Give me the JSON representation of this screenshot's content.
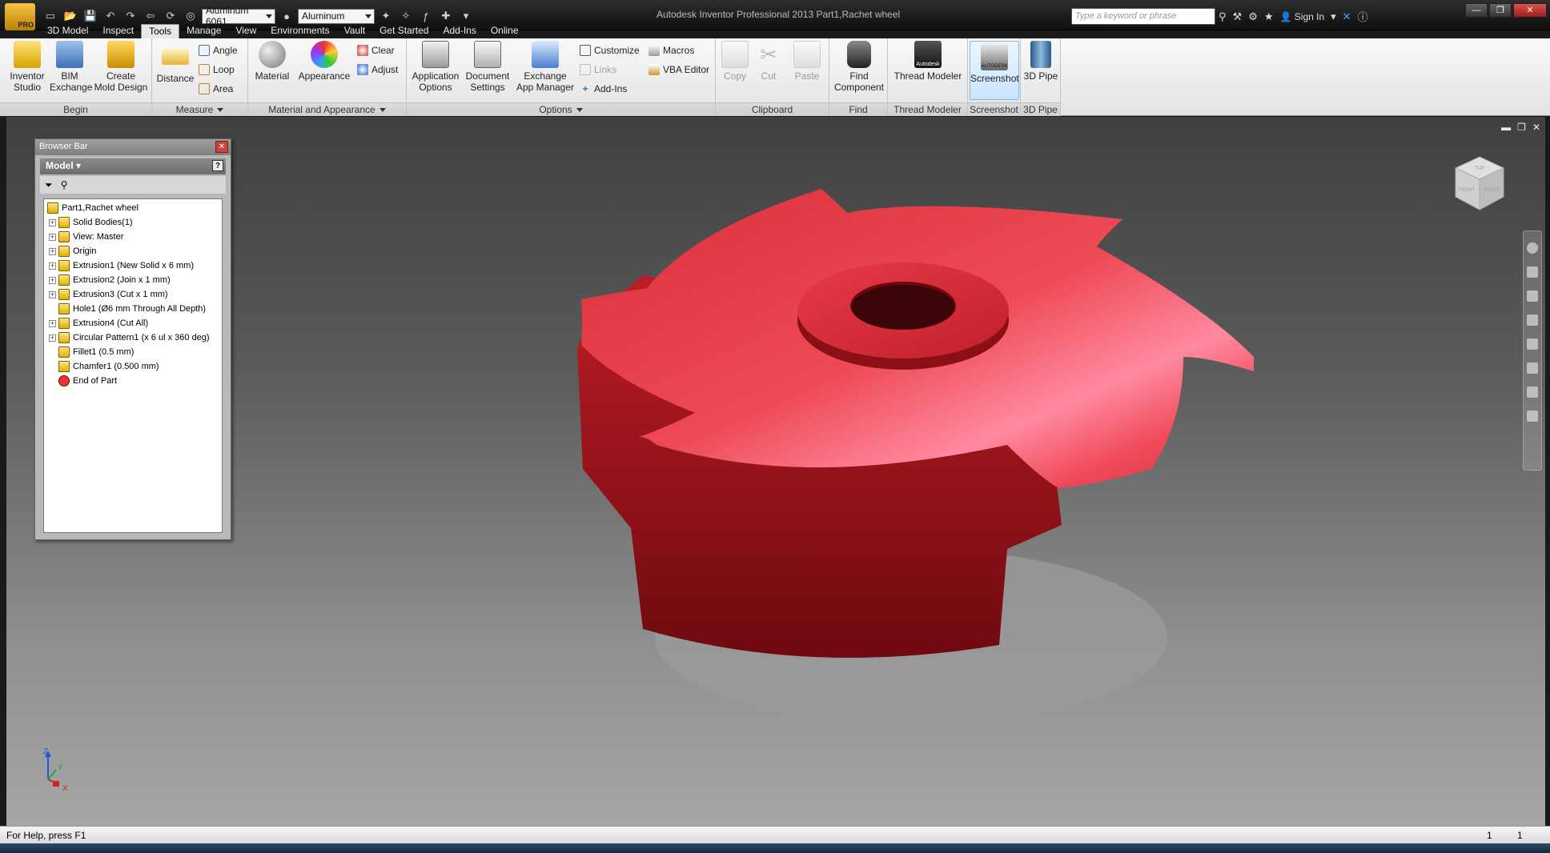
{
  "app": {
    "badge": "PRO",
    "title": "Autodesk Inventor Professional 2013    Part1,Rachet wheel"
  },
  "qat": {
    "material": "Aluminum 6061",
    "appearance": "Aluminum"
  },
  "help": {
    "search_placeholder": "Type a keyword or phrase",
    "signin": "Sign In"
  },
  "tabs": [
    "3D Model",
    "Inspect",
    "Tools",
    "Manage",
    "View",
    "Environments",
    "Vault",
    "Get Started",
    "Add-Ins",
    "Online"
  ],
  "ribbon": {
    "begin": {
      "label": "Begin",
      "inventor_studio": [
        "Inventor",
        "Studio"
      ],
      "bim_exchange": [
        "BIM",
        "Exchange"
      ],
      "create_mold": [
        "Create",
        "Mold Design"
      ]
    },
    "measure": {
      "label": "Measure",
      "distance": "Distance",
      "angle": "Angle",
      "loop": "Loop",
      "area": "Area"
    },
    "material": {
      "label": "Material and Appearance",
      "material": "Material",
      "appearance": "Appearance",
      "clear": "Clear",
      "adjust": "Adjust"
    },
    "options": {
      "label": "Options",
      "application_options": [
        "Application",
        "Options"
      ],
      "document_settings": [
        "Document",
        "Settings"
      ],
      "exchange_app_manager": [
        "Exchange",
        "App Manager"
      ],
      "customize": "Customize",
      "links": "Links",
      "add_ins": "Add-Ins",
      "macros": "Macros",
      "vba_editor": "VBA Editor"
    },
    "clipboard": {
      "label": "Clipboard",
      "copy": "Copy",
      "cut": "Cut",
      "paste": "Paste"
    },
    "find": {
      "label": "Find",
      "find_component": [
        "Find",
        "Component"
      ]
    },
    "thread": {
      "label": "Thread Modeler",
      "button": "Thread Modeler",
      "logo_text": "Autodesk"
    },
    "screenshot": {
      "label": "Screenshot",
      "button": "Screenshot",
      "logo_text": "AUTODESK"
    },
    "pipe": {
      "label": "3D Pipe",
      "button": "3D Pipe"
    }
  },
  "browser": {
    "title": "Browser Bar",
    "model_label": "Model",
    "help_glyph": "?",
    "nodes": [
      {
        "label": "Part1,Rachet wheel",
        "expandable": false,
        "indent": 0
      },
      {
        "label": "Solid Bodies(1)",
        "expandable": true,
        "indent": 1
      },
      {
        "label": "View: Master",
        "expandable": true,
        "indent": 1
      },
      {
        "label": "Origin",
        "expandable": true,
        "indent": 1
      },
      {
        "label": "Extrusion1 (New Solid x 6 mm)",
        "expandable": true,
        "indent": 1
      },
      {
        "label": "Extrusion2 (Join x 1 mm)",
        "expandable": true,
        "indent": 1
      },
      {
        "label": "Extrusion3 (Cut x 1 mm)",
        "expandable": true,
        "indent": 1
      },
      {
        "label": "Hole1 (Ø6 mm Through All Depth)",
        "expandable": false,
        "indent": 1
      },
      {
        "label": "Extrusion4 (Cut All)",
        "expandable": true,
        "indent": 1
      },
      {
        "label": "Circular Pattern1 (x 6 ul x 360 deg)",
        "expandable": true,
        "indent": 1
      },
      {
        "label": "Fillet1 (0.5 mm)",
        "expandable": false,
        "indent": 1
      },
      {
        "label": "Chamfer1 (0.500 mm)",
        "expandable": false,
        "indent": 1
      },
      {
        "label": "End of Part",
        "expandable": false,
        "indent": 1
      }
    ]
  },
  "viewcube": {
    "front": "FRONT",
    "right": "RIGHT",
    "top": "TOP"
  },
  "triad": {
    "x": "X",
    "y": "Y",
    "z": "Z"
  },
  "status": {
    "help": "For Help, press F1",
    "num1": "1",
    "num2": "1"
  },
  "colors": {
    "part": "#d42a32",
    "ribbon_highlight": "#c9e6ff",
    "viewport_top": "#404040",
    "viewport_bottom": "#a6a6a6"
  }
}
